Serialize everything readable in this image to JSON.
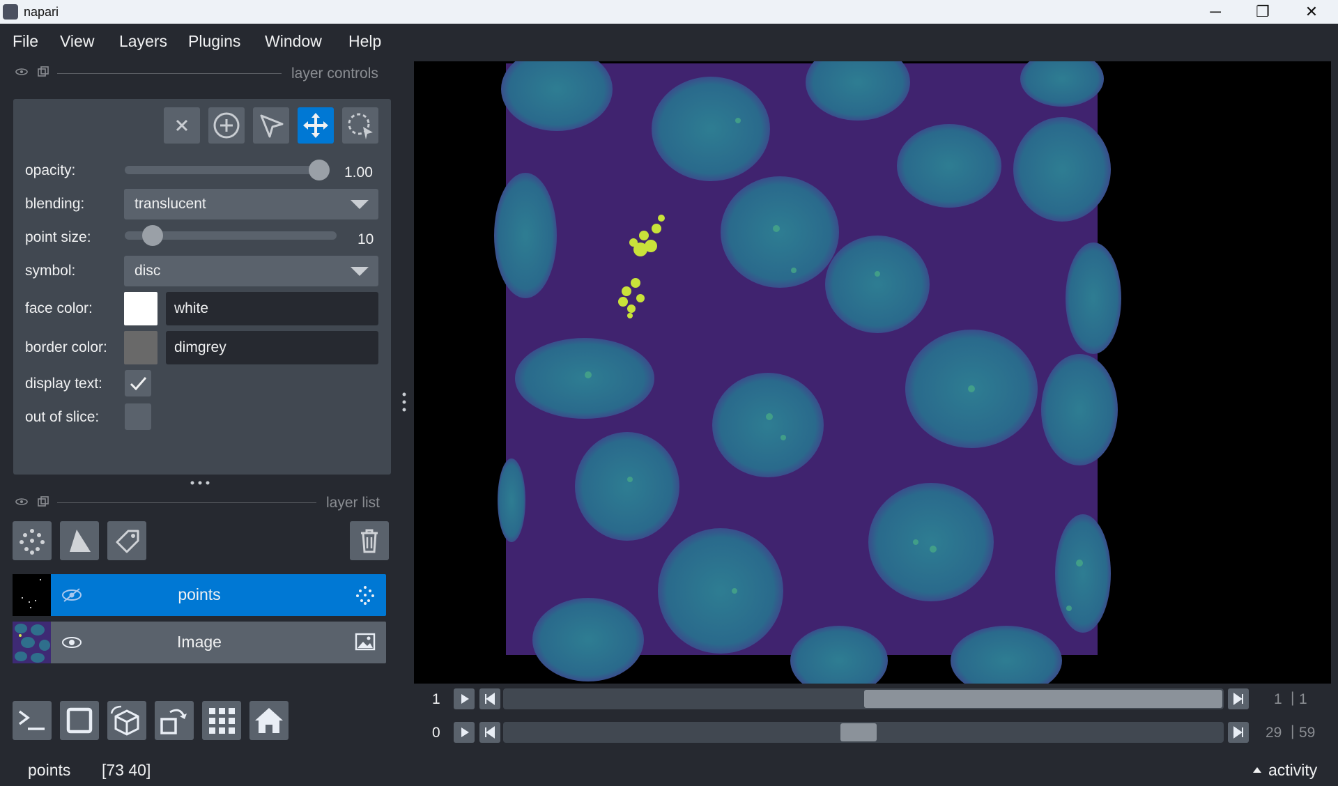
{
  "window": {
    "title": "napari",
    "minimize": "─",
    "restore": "❐",
    "close": "✕"
  },
  "menu": [
    "File",
    "View",
    "Layers",
    "Plugins",
    "Window",
    "Help"
  ],
  "layer_controls": {
    "header": "layer controls",
    "opacity_label": "opacity:",
    "opacity_value": "1.00",
    "blending_label": "blending:",
    "blending_value": "translucent",
    "point_size_label": "point size:",
    "point_size_value": "10",
    "symbol_label": "symbol:",
    "symbol_value": "disc",
    "face_color_label": "face color:",
    "face_color_value": "white",
    "face_color_hex": "#ffffff",
    "border_color_label": "border color:",
    "border_color_value": "dimgrey",
    "border_color_hex": "#696969",
    "display_text_label": "display text:",
    "display_text_checked": true,
    "out_of_slice_label": "out of slice:",
    "out_of_slice_checked": false
  },
  "layer_list": {
    "header": "layer list",
    "layers": [
      {
        "name": "points",
        "selected": true,
        "type": "points"
      },
      {
        "name": "Image",
        "selected": false,
        "type": "image"
      }
    ]
  },
  "dims": [
    {
      "axis_label": "1",
      "current": "1",
      "total": "1",
      "position_fraction": 0.5
    },
    {
      "axis_label": "0",
      "current": "29",
      "total": "59",
      "position_fraction": 0.49
    }
  ],
  "status": {
    "layer": "points",
    "coords": "[73 40]",
    "activity": "activity"
  },
  "colors": {
    "accent": "#0078d4",
    "background": "#262930",
    "panel": "#414851"
  }
}
